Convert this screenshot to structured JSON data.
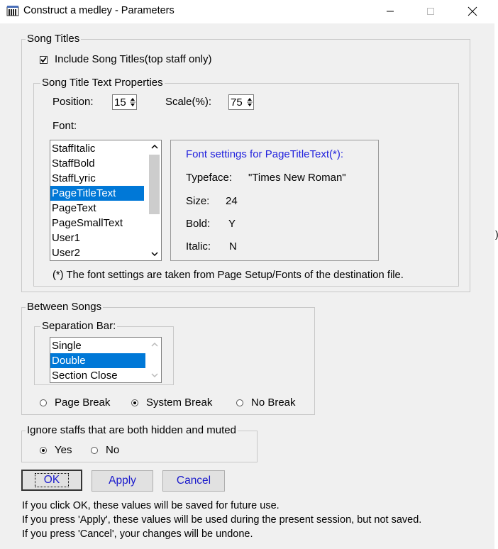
{
  "window": {
    "title": "Construct a medley - Parameters",
    "controls": {
      "minimize": "—",
      "maximize": "☐",
      "close": "✕"
    }
  },
  "song_titles": {
    "legend": "Song Titles",
    "include_label": "Include Song Titles(top staff only)",
    "include_checked": true,
    "text_props": {
      "legend": "Song Title Text Properties",
      "position_label": "Position:",
      "position_value": "15",
      "scale_label": "Scale(%):",
      "scale_value": "75",
      "font_label": "Font:",
      "font_list": [
        "StaffItalic",
        "StaffBold",
        "StaffLyric",
        "PageTitleText",
        "PageText",
        "PageSmallText",
        "User1",
        "User2"
      ],
      "font_selected": "PageTitleText",
      "font_settings": {
        "heading": "Font settings for PageTitleText(*):",
        "typeface_label": "Typeface:",
        "typeface_value": "\"Times New Roman\"",
        "size_label": "Size:",
        "size_value": "24",
        "bold_label": "Bold:",
        "bold_value": "Y",
        "italic_label": "Italic:",
        "italic_value": "N"
      },
      "note": "(*) The font settings are taken from Page Setup/Fonts of the destination file."
    }
  },
  "between_songs": {
    "legend": "Between Songs",
    "separation_legend": "Separation Bar:",
    "separation_options": [
      "Single",
      "Double",
      "Section Close"
    ],
    "separation_selected": "Double",
    "break_options": [
      "Page Break",
      "System Break",
      "No Break"
    ],
    "break_selected": "System Break"
  },
  "ignore_staffs": {
    "legend": "Ignore staffs that are both hidden and muted",
    "options": [
      "Yes",
      "No"
    ],
    "selected": "Yes"
  },
  "buttons": {
    "ok": "OK",
    "apply": "Apply",
    "cancel": "Cancel"
  },
  "info_lines": [
    "If you click OK, these values will be saved for future use.",
    "If you press 'Apply', these values will be used during the present session, but not saved.",
    "If you press 'Cancel', your changes will be undone."
  ],
  "colors": {
    "accent": "#0078d7",
    "button_text": "#1a1acc",
    "heading_blue": "#2222dd"
  },
  "icons": {
    "app": "staff-piano-icon",
    "scroll_up": "chevron-up-icon",
    "scroll_down": "chevron-down-icon"
  }
}
